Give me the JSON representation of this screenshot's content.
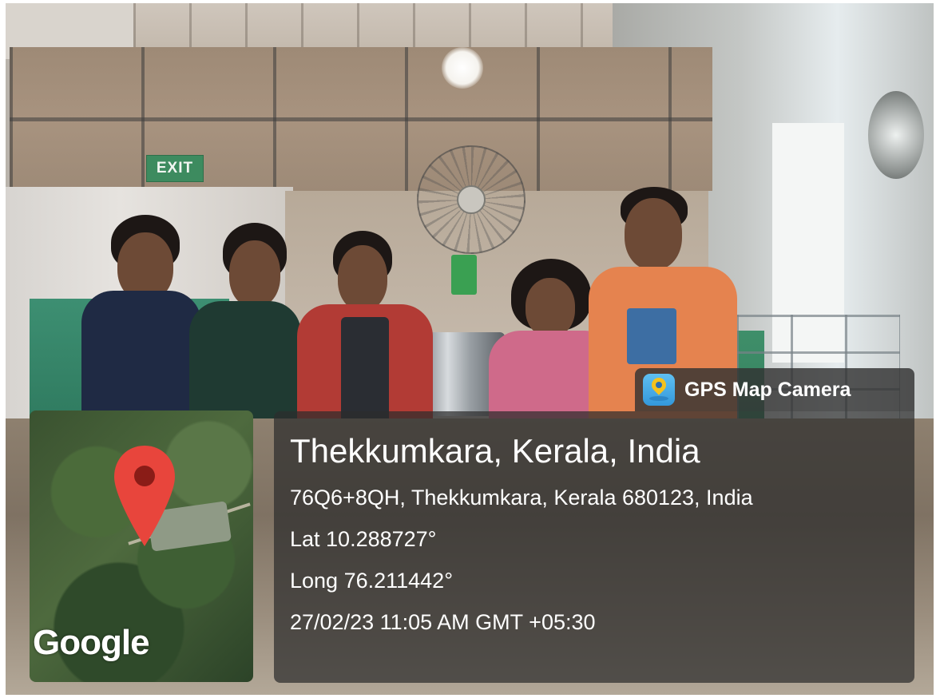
{
  "scene": {
    "exit_sign": "EXIT"
  },
  "map": {
    "provider_logo": "Google",
    "pin_icon": "map-pin-icon",
    "pin_color": "#e8453c"
  },
  "camera_app": {
    "icon": "gps-map-camera-app-icon",
    "label": "GPS Map Camera"
  },
  "location": {
    "title": "Thekkumkara, Kerala, India",
    "address": "76Q6+8QH, Thekkumkara, Kerala 680123, India",
    "latitude": "Lat 10.288727°",
    "longitude": "Long 76.211442°",
    "timestamp": "27/02/23 11:05 AM GMT +05:30"
  },
  "colors": {
    "overlay_background": "#2d2d2d",
    "overlay_text": "#ffffff",
    "app_icon_blue": "#3398db"
  }
}
